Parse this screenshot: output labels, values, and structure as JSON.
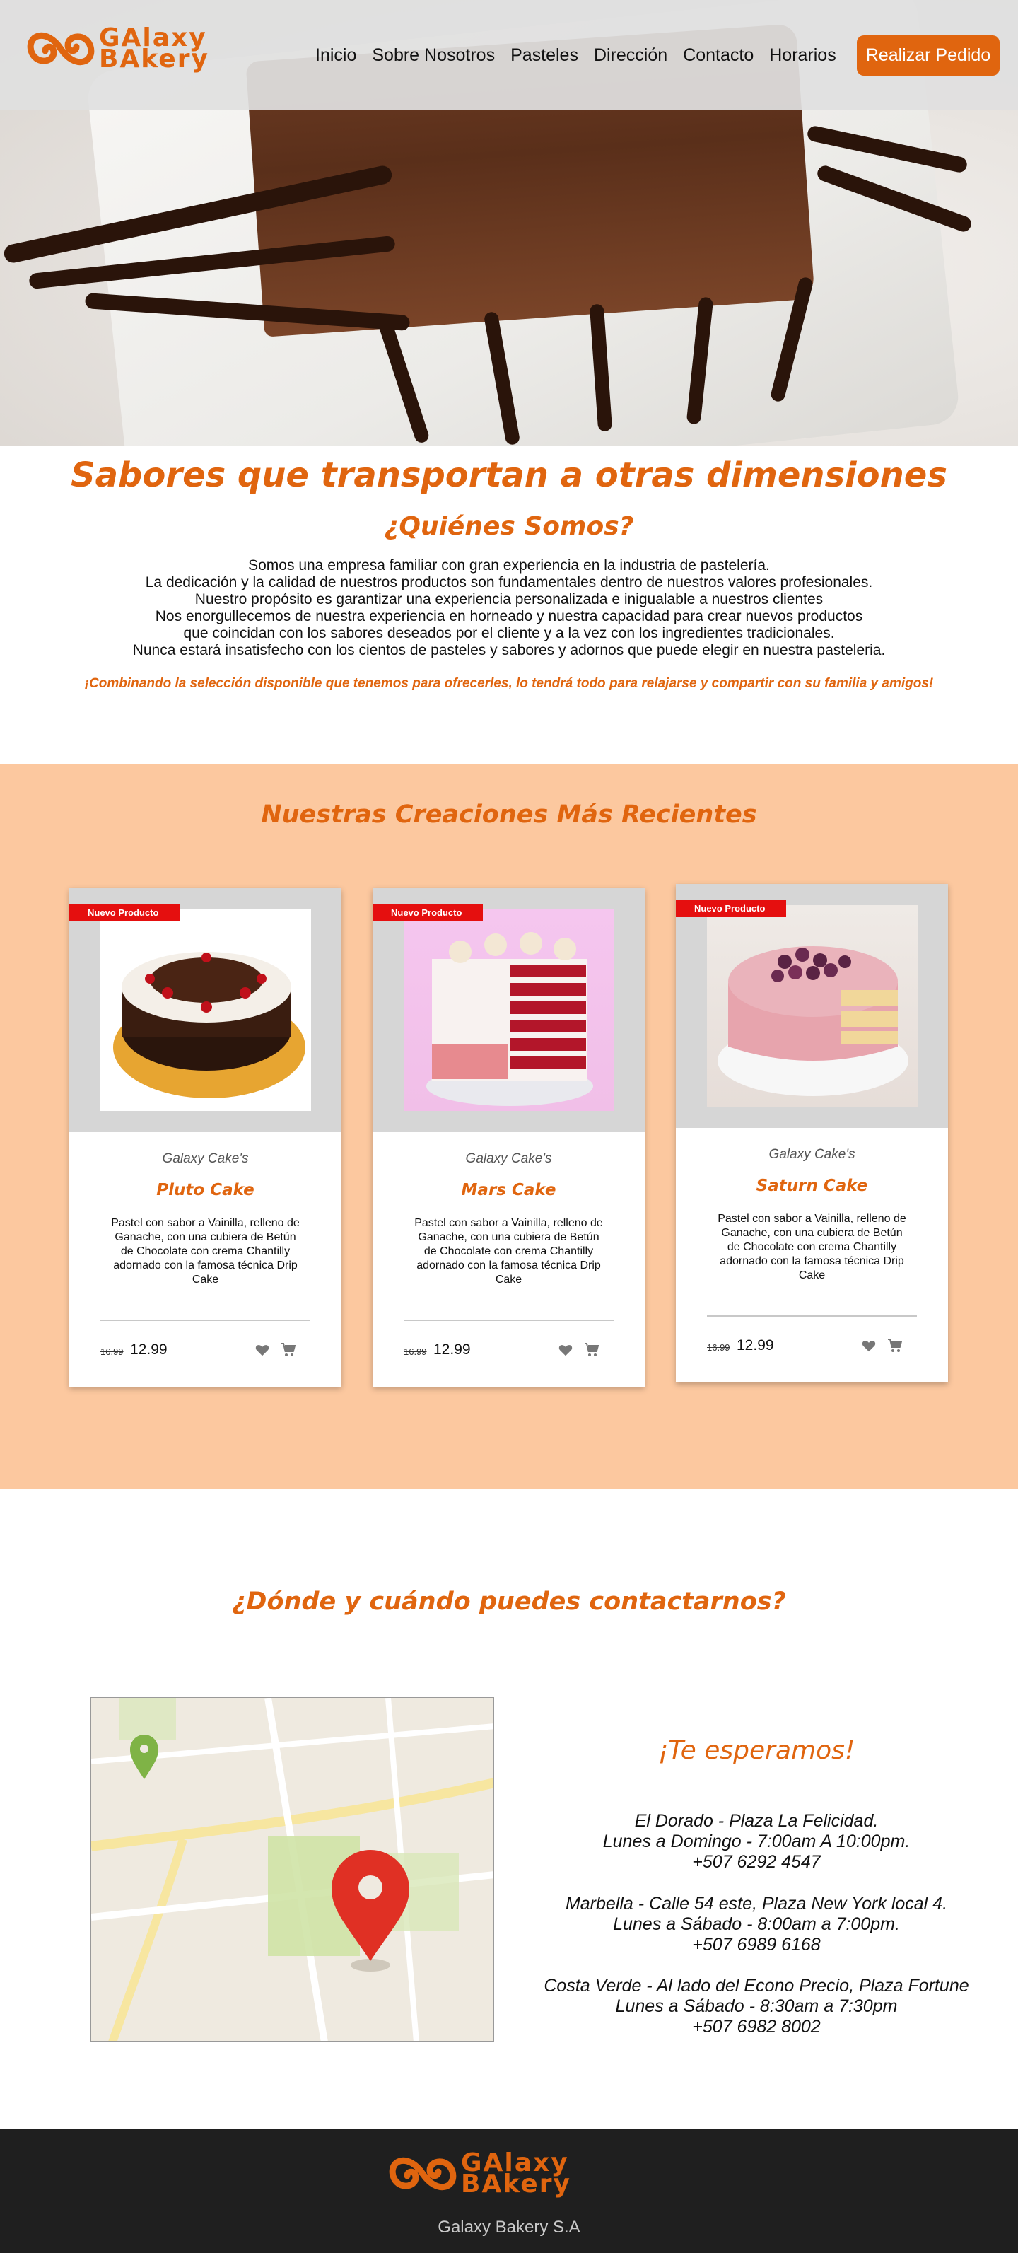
{
  "header": {
    "logo_line1": "GAlaxy",
    "logo_line2": "BAkery",
    "nav": [
      "Inicio",
      "Sobre Nosotros",
      "Pasteles",
      "Dirección",
      "Contacto",
      "Horarios"
    ],
    "order_button": "Realizar Pedido"
  },
  "about": {
    "tagline": "Sabores que transportan a otras dimensiones",
    "heading": "¿Quiénes Somos?",
    "lines": [
      "Somos una empresa familiar con gran experiencia en la industria de pastelería.",
      "La dedicación y la calidad de nuestros productos son fundamentales dentro de nuestros valores profesionales.",
      "Nuestro propósito es garantizar una experiencia personalizada e inigualable a nuestros clientes",
      "Nos enorgullecemos de nuestra experiencia en horneado y nuestra capacidad para crear nuevos productos",
      "que coincidan con los sabores deseados por el cliente y a la vez con los ingredientes tradicionales.",
      "Nunca estará insatisfecho con los cientos de pasteles y sabores y adornos que puede elegir en nuestra pasteleria."
    ],
    "slogan": "¡Combinando la selección disponible que tenemos para ofrecerles, lo tendrá todo para relajarse y compartir con su familia y amigos!"
  },
  "products": {
    "title": "Nuestras Creaciones Más Recientes",
    "items": [
      {
        "badge": "Nuevo Producto",
        "brand": "Galaxy Cake's",
        "name": "Pluto Cake",
        "description": "Pastel con sabor a Vainilla, relleno de Ganache, con una cubiera de Betún de Chocolate con crema Chantilly adornado con la famosa técnica Drip Cake",
        "old_price": "16.99",
        "price": "12.99"
      },
      {
        "badge": "Nuevo Producto",
        "brand": "Galaxy Cake's",
        "name": "Mars Cake",
        "description": "Pastel con sabor a Vainilla, relleno de Ganache, con una cubiera de Betún de Chocolate con crema Chantilly adornado con la famosa técnica Drip Cake",
        "old_price": "16.99",
        "price": "12.99"
      },
      {
        "badge": "Nuevo Producto",
        "brand": "Galaxy Cake's",
        "name": "Saturn Cake",
        "description": "Pastel con sabor a Vainilla, relleno de Ganache, con una cubiera de Betún de Chocolate con crema Chantilly adornado con la famosa técnica Drip Cake",
        "old_price": "16.99",
        "price": "12.99"
      }
    ]
  },
  "contact": {
    "title": "¿Dónde y cuándo puedes contactarnos?",
    "welcome": "¡Te esperamos!",
    "branches": [
      [
        "El Dorado - Plaza La Felicidad.",
        "Lunes a Domingo - 7:00am A 10:00pm.",
        "+507 6292 4547"
      ],
      [
        "Marbella - Calle 54 este, Plaza New York local 4.",
        "Lunes a Sábado - 8:00am a 7:00pm.",
        "+507 6989 6168"
      ],
      [
        "Costa Verde - Al lado del Econo Precio, Plaza Fortune",
        "Lunes a Sábado - 8:30am a 7:30pm",
        "+507 6982 8002"
      ]
    ]
  },
  "footer": {
    "company": "Galaxy Bakery S.A"
  },
  "colors": {
    "accent": "#e0650f",
    "products_bg": "#fcc89f",
    "badge": "#e50f0f",
    "footer_bg": "#1f1f1f"
  }
}
